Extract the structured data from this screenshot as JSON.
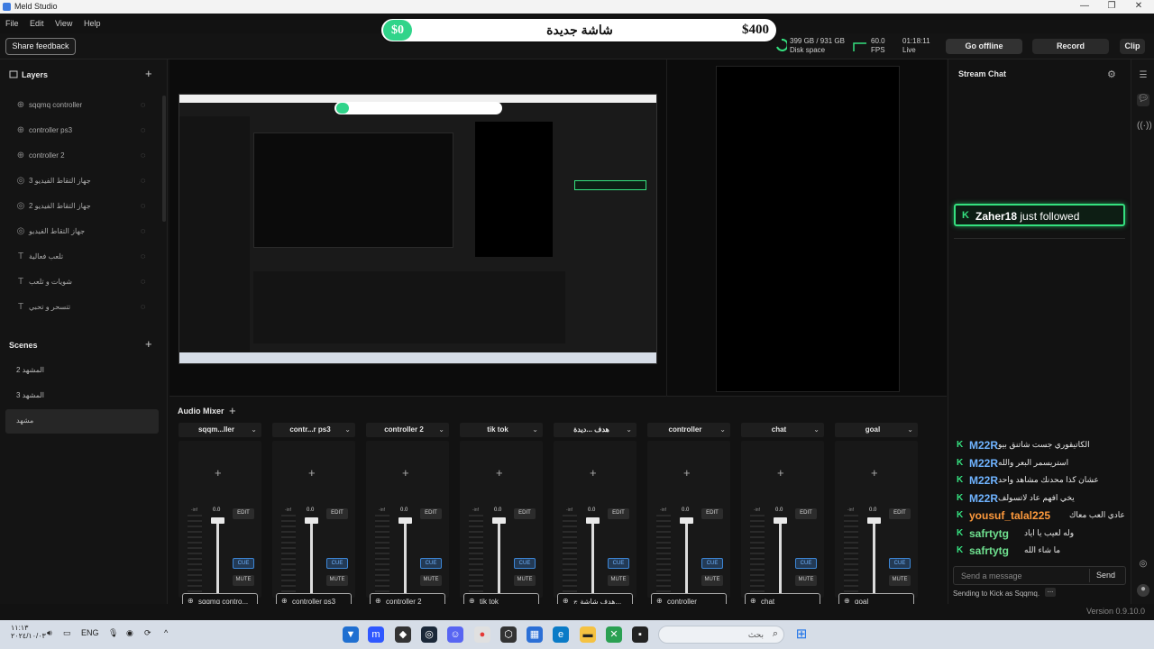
{
  "window": {
    "title": "Meld Studio",
    "minimize": "—",
    "maximize": "❐",
    "close": "✕"
  },
  "menu": [
    "File",
    "Edit",
    "View",
    "Help"
  ],
  "goal": {
    "current": "$0",
    "title": "شاشة جديدة",
    "target": "$400"
  },
  "toolbar": {
    "share_feedback": "Share feedback",
    "disk_value": "399 GB / 931 GB",
    "disk_label": "Disk space",
    "fps_value": "60.0",
    "fps_label": "FPS",
    "time_value": "01:18:11",
    "time_label": "Live",
    "go_offline": "Go offline",
    "record": "Record",
    "clip": "Clip"
  },
  "layers": {
    "title": "Layers",
    "add": "+",
    "items": [
      {
        "label": "sqqmq controller",
        "icon": "globe-icon"
      },
      {
        "label": "controller ps3",
        "icon": "globe-icon"
      },
      {
        "label": "controller 2",
        "icon": "globe-icon"
      },
      {
        "label": "جهاز التقاط الفيديو 3",
        "icon": "camera-icon"
      },
      {
        "label": "جهاز التقاط الفيديو 2",
        "icon": "camera-icon"
      },
      {
        "label": "جهاز التقاط الفيديو",
        "icon": "camera-icon"
      },
      {
        "label": "تلعب فعالية",
        "icon": "text-icon"
      },
      {
        "label": "شويات و تلعب",
        "icon": "text-icon"
      },
      {
        "label": "تتسحر و تحبي",
        "icon": "text-icon"
      }
    ]
  },
  "scenes": {
    "title": "Scenes",
    "add": "+",
    "items": [
      "المشهد 2",
      "المشهد 3",
      "مشهد"
    ],
    "active_index": 2
  },
  "mixer": {
    "title": "Audio Mixer",
    "add": "+",
    "strips": [
      {
        "name": "sqqm...ller",
        "footer": "sqqmq contro..."
      },
      {
        "name": "contr...r ps3",
        "footer": "controller ps3"
      },
      {
        "name": "controller 2",
        "footer": "controller 2"
      },
      {
        "name": "tik tok",
        "footer": "tik tok"
      },
      {
        "name": "هدف ...ديدة",
        "footer": "هدف شاشة ج..."
      },
      {
        "name": "controller",
        "footer": "controller"
      },
      {
        "name": "chat",
        "footer": "chat"
      },
      {
        "name": "goal",
        "footer": "goal"
      }
    ],
    "level_label": "0.0",
    "inf_label": "-inf",
    "edit_label": "EDIT",
    "cue_label": "CUE",
    "mute_label": "MUTE",
    "add_source": "+"
  },
  "chat": {
    "title": "Stream Chat",
    "follow_user": "Zaher18",
    "follow_text": " just followed",
    "messages": [
      {
        "user": "M22R",
        "text": "الكاتيقوري جست شاتنق بيو",
        "color": "#6fb3ff"
      },
      {
        "user": "M22R",
        "text": "استريسمر البعر والله",
        "color": "#6fb3ff"
      },
      {
        "user": "M22R",
        "text": "عشان كذا محدنك مشاهد واحد",
        "color": "#6fb3ff"
      },
      {
        "user": "M22R",
        "text": "يخي افهم عاد لاتسولف",
        "color": "#6fb3ff"
      },
      {
        "user": "yousuf_talal225",
        "text": "عادي العب معاك",
        "color": "#ff9a3c"
      },
      {
        "user": "safrtytg",
        "text": "وله لعيب يا اياد",
        "color": "#6fe08f"
      },
      {
        "user": "safrtytg",
        "text": "ما شاء الله",
        "color": "#6fe08f"
      }
    ],
    "input_placeholder": "Send a message",
    "send": "Send",
    "sending_as": "Sending to Kick as Sqqmq.",
    "dots": "..."
  },
  "status": {
    "version": "Version 0.9.10.0"
  },
  "taskbar": {
    "time": "١١:١٣",
    "date": "٢٠٢٤/١٠/٠٣",
    "lang": "ENG",
    "search": "بحث"
  }
}
